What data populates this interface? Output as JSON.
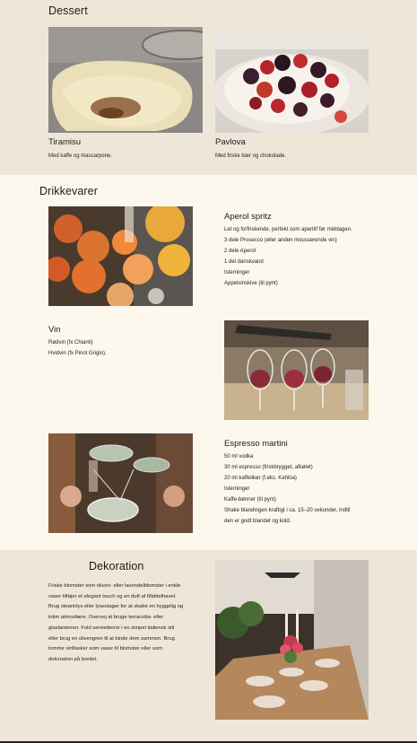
{
  "dessert": {
    "heading": "Dessert",
    "items": [
      {
        "title": "Tiramisu",
        "desc": "Med kaffe og mascarpone."
      },
      {
        "title": "Pavlova",
        "desc": "Med friske bær og chokolade."
      }
    ]
  },
  "drinks": {
    "heading": "Drikkevarer",
    "aperol": {
      "title": "Aperol spritz",
      "lines": [
        "Let og forfriskende, perfekt som aperitif før middagen.",
        "3 dele Prosecco (eller anden mousserende vin)",
        "2 dele Aperol",
        "1 del danskvand",
        "Isterninger",
        "Appelsinskive (til pynt)"
      ]
    },
    "vin": {
      "title": "Vin",
      "lines": [
        "Rødvin (fx Chianti)",
        "Hvidvin (fx Pinot Grigio)."
      ]
    },
    "espresso": {
      "title": "Espresso martini",
      "lines": [
        "50 ml vodka",
        "30 ml espresso (friskbrygget, afkølet)",
        "20 ml kaffelikør (f.eks. Kahlúa)",
        "Isterninger",
        "Kaffe-bønner (til pynt)",
        "Shake blandingen kraftigt i ca. 15–20 sekunder, indtil",
        "den er godt blandet og kold."
      ]
    }
  },
  "decoration": {
    "heading": "Dekoration",
    "lines": [
      "Friske blomster som oliven- eller lavendelblomster i enkle",
      "vaser tilføjer et elegant touch og en duft af Middelhavet.",
      "Brug stearinlys eller lysestager for at skabe en hyggelig og",
      "intim atmosfære. Overvej at bruge terracotta- eller",
      "glaslanterner. Fold servietterne i en simpel italiensk stil",
      "eller brug en olivengren til at binde dem sammen. Brug",
      "tomme vinflasker som vaser til blomster eller som",
      "dekoration på bordet."
    ]
  }
}
